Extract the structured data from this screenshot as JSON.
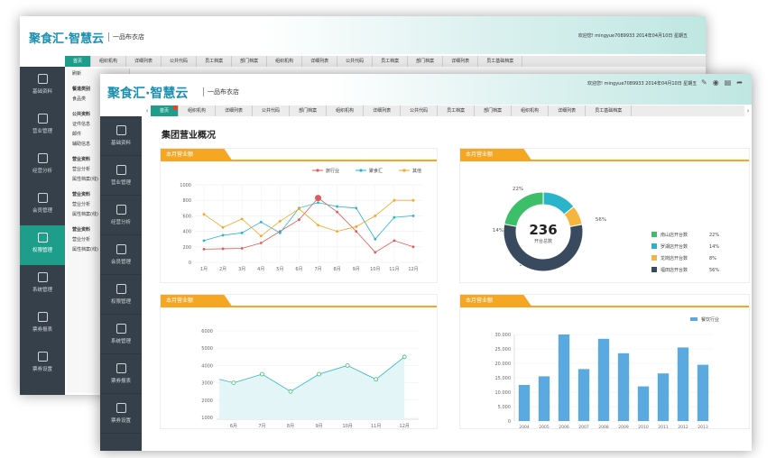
{
  "app": {
    "logo": "聚食汇·智慧云",
    "shop": "一品布衣店",
    "top_info": "欢迎您!  mingyue7089933    2014年04月10日    星期五"
  },
  "tabs": [
    {
      "label": "首页",
      "active": true
    },
    {
      "label": "组织机构"
    },
    {
      "label": "详细列表"
    },
    {
      "label": "公共代码"
    },
    {
      "label": "部门档案"
    },
    {
      "label": "组织机构"
    },
    {
      "label": "详细列表"
    },
    {
      "label": "公共代码"
    },
    {
      "label": "员工档案"
    },
    {
      "label": "部门档案"
    },
    {
      "label": "组织机构"
    },
    {
      "label": "详细列表"
    },
    {
      "label": "员工基础档案"
    }
  ],
  "back_tabs": [
    "首页",
    "组织机构",
    "详细列表",
    "公共代码",
    "员工档案",
    "部门档案",
    "组织机构",
    "详细列表",
    "公共代码",
    "员工档案",
    "部门档案",
    "详细列表",
    "员工基础档案"
  ],
  "sidebar": [
    {
      "label": "基础资料",
      "icon": "document-icon"
    },
    {
      "label": "营业管理",
      "icon": "monitor-icon"
    },
    {
      "label": "经营分析",
      "icon": "pie-chart-icon"
    },
    {
      "label": "会员管理",
      "icon": "member-icon"
    },
    {
      "label": "权限管理",
      "icon": "lock-icon"
    },
    {
      "label": "系统管理",
      "icon": "gear-icon"
    },
    {
      "label": "票券报表",
      "icon": "report-icon"
    },
    {
      "label": "票券设置",
      "icon": "settings-icon"
    }
  ],
  "back_tree": {
    "toolbar": "刷新",
    "title": "餐道类别",
    "rows": [
      "食品类",
      "公共资料",
      "证件信息",
      "邮件",
      "辅助信息",
      "营业资料",
      "营业分析",
      "属性档案(线)",
      "营业资料",
      "营业分析",
      "属性档案(线)",
      "营业资料",
      "营业分析",
      "属性档案(线)"
    ]
  },
  "page_title": "集团营业概况",
  "panels": {
    "line_top": "本月营业额",
    "donut": "本月营业额",
    "area": "本月营业额",
    "bar": "本月营业额"
  },
  "colors": {
    "accent": "#1e9e8a",
    "orange": "#f5a623",
    "sidebar": "#35404a",
    "red": "#e0452f"
  },
  "chart_data": [
    {
      "type": "line",
      "categories": [
        "1月",
        "2月",
        "3月",
        "4月",
        "5月",
        "6月",
        "7月",
        "8月",
        "9月",
        "10月",
        "11月",
        "12月"
      ],
      "ylim": [
        0,
        1000
      ],
      "yticks": [
        0,
        200,
        400,
        600,
        800,
        1000
      ],
      "series": [
        {
          "name": "旅行业",
          "color": "#e25a5a",
          "values": [
            170,
            175,
            180,
            250,
            400,
            550,
            830,
            650,
            400,
            130,
            280,
            200
          ]
        },
        {
          "name": "聚食汇",
          "color": "#2ab4c9",
          "values": [
            280,
            350,
            380,
            520,
            380,
            700,
            770,
            720,
            700,
            300,
            580,
            600
          ]
        },
        {
          "name": "其他",
          "color": "#f5a623",
          "values": [
            620,
            450,
            560,
            340,
            530,
            690,
            480,
            400,
            460,
            600,
            800,
            800
          ]
        }
      ]
    },
    {
      "type": "pie",
      "center_value": "236",
      "center_label": "开台总数",
      "slices": [
        {
          "name": "南山店开台数",
          "value": 22,
          "label": "22%",
          "color": "#3dbf6a"
        },
        {
          "name": "罗湖店开台数",
          "value": 14,
          "label": "14%",
          "color": "#2ab4c9"
        },
        {
          "name": "龙岗店开台数",
          "value": 8,
          "label": "8%",
          "color": "#f5b53f"
        },
        {
          "name": "福田店开台数",
          "value": 56,
          "label": "56%",
          "color": "#3a4a5e"
        }
      ]
    },
    {
      "type": "area",
      "categories": [
        "6月",
        "7月",
        "8月",
        "9月",
        "10月",
        "11月",
        "12月"
      ],
      "ylim": [
        1000,
        6000
      ],
      "yticks": [
        1000,
        2000,
        3000,
        4000,
        5000,
        6000
      ],
      "x": [
        5.5,
        6,
        7,
        8,
        9,
        10,
        11,
        12
      ],
      "values": [
        3200,
        3000,
        3500,
        2500,
        3500,
        4000,
        3200,
        4500
      ],
      "color": "#2ab4c9"
    },
    {
      "type": "bar",
      "legend": "餐饮行业",
      "categories": [
        "2004",
        "2005",
        "2006",
        "2007",
        "2008",
        "2009",
        "2010",
        "2011",
        "2012",
        "2013"
      ],
      "ylim": [
        0,
        30000
      ],
      "yticks": [
        0,
        5000,
        10000,
        15000,
        20000,
        25000,
        30000
      ],
      "tick_labels": [
        "0",
        "5.000",
        "10.000",
        "15.000",
        "20.000",
        "25.000",
        "30.000"
      ],
      "values": [
        12500,
        15500,
        30000,
        18000,
        28500,
        23500,
        12000,
        16500,
        25500,
        19500
      ],
      "color": "#5aa9e0"
    }
  ]
}
